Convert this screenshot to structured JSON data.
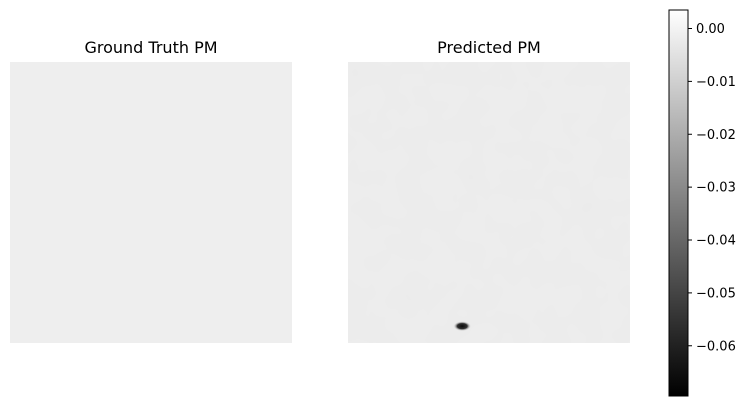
{
  "chart_data": {
    "type": "heatmap",
    "colormap": "gray",
    "color_range": [
      -0.0695,
      0.0035
    ],
    "panels": [
      {
        "title": "Ground Truth PM",
        "background_value": -0.0015,
        "axes_visible": false
      },
      {
        "title": "Predicted PM",
        "background_value": -0.0015,
        "axes_visible": false,
        "features": [
          {
            "kind": "dark-spot",
            "x": 0.405,
            "y": 0.94,
            "value": -0.069
          }
        ]
      }
    ],
    "colorbar": {
      "ticks": [
        {
          "value": 0.0,
          "label": "0.00"
        },
        {
          "value": -0.01,
          "label": "−0.01"
        },
        {
          "value": -0.02,
          "label": "−0.02"
        },
        {
          "value": -0.03,
          "label": "−0.03"
        },
        {
          "value": -0.04,
          "label": "−0.04"
        },
        {
          "value": -0.05,
          "label": "−0.05"
        },
        {
          "value": -0.06,
          "label": "−0.06"
        }
      ]
    }
  }
}
